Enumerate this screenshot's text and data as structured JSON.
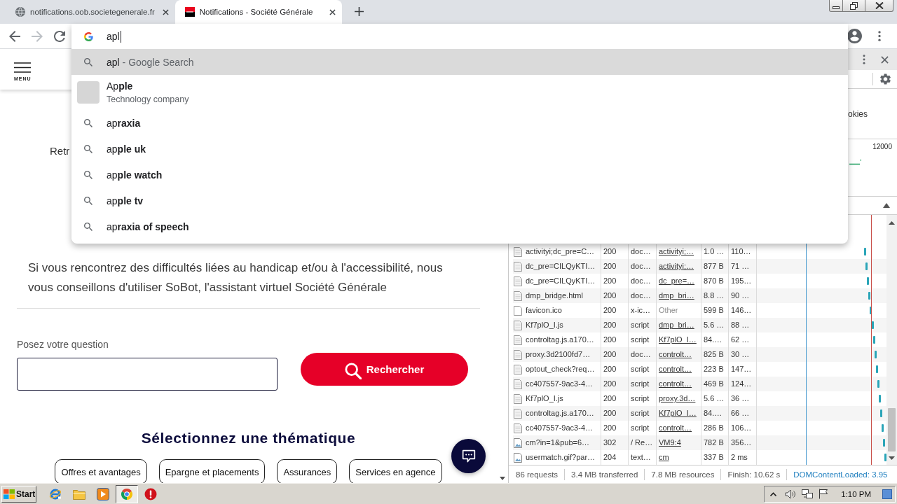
{
  "browser": {
    "tabs": [
      {
        "kind": "generic",
        "title": "notifications.oob.societegenerale.fr",
        "selected": false
      },
      {
        "kind": "site",
        "title": "Notifications - Société Générale",
        "selected": true
      }
    ],
    "nav_buttons": [
      {
        "kind": "back",
        "disabled": false
      },
      {
        "kind": "forward",
        "disabled": true
      },
      {
        "kind": "reload",
        "disabled": false
      }
    ],
    "omnibox": {
      "value": "apl",
      "suggestions": [
        {
          "kind": "search",
          "text": "apl",
          "description": "- Google Search",
          "selected": true
        },
        {
          "kind": "entity",
          "text": "Ap**ple**",
          "description": "Technology company",
          "selected": false
        },
        {
          "kind": "search",
          "text": "ap**raxia**",
          "selected": false
        },
        {
          "kind": "search",
          "text": "ap**ple uk**",
          "selected": false
        },
        {
          "kind": "search",
          "text": "ap**ple watch**",
          "selected": false
        },
        {
          "kind": "search",
          "text": "ap**ple tv**",
          "selected": false
        },
        {
          "kind": "search",
          "text": "ap**raxia of speech**",
          "selected": false
        }
      ]
    }
  },
  "page": {
    "menu_label": "MENU",
    "partial_text": "Retr",
    "notice": "Si vous rencontrez des difficultés liées au handicap et/ou à l'accessibilité, nous vous conseillons d'utiliser SoBot, l'assistant virtuel Société Générale",
    "question_label": "Posez votre question",
    "search_button": "Rechercher",
    "themes_heading": "Sélectionnez une thématique",
    "themes": [
      "Offres et avantages",
      "Epargne et placements",
      "Assurances",
      "Services en agence"
    ]
  },
  "devtools": {
    "filter_fragment": "okies",
    "overview_tick": "12000",
    "requests": [
      {
        "kind": "document",
        "name": "activityi;dc_pre=C…",
        "status": "200",
        "type": "doc…",
        "initiator": "activityi;…",
        "initiator_link": true,
        "size": "1.0 …",
        "time": "110…"
      },
      {
        "kind": "document",
        "name": "dc_pre=CILQyKTI…",
        "status": "200",
        "type": "doc…",
        "initiator": "activityi;…",
        "initiator_link": true,
        "size": "877 B",
        "time": "71 …"
      },
      {
        "kind": "document",
        "name": "dc_pre=CILQyKTI…",
        "status": "200",
        "type": "doc…",
        "initiator": "dc_pre=…",
        "initiator_link": true,
        "size": "870 B",
        "time": "195…"
      },
      {
        "kind": "document",
        "name": "dmp_bridge.html",
        "status": "200",
        "type": "doc…",
        "initiator": "dmp_bri…",
        "initiator_link": true,
        "size": "8.8 …",
        "time": "90 …"
      },
      {
        "kind": "blank",
        "name": "favicon.ico",
        "status": "200",
        "type": "x-ic…",
        "initiator": "Other",
        "initiator_link": false,
        "size": "599 B",
        "time": "146…"
      },
      {
        "kind": "document",
        "name": "Kf7plO_I.js",
        "status": "200",
        "type": "script",
        "initiator": "dmp_bri…",
        "initiator_link": true,
        "size": "5.6 …",
        "time": "88 …"
      },
      {
        "kind": "document",
        "name": "controltag.js.a170…",
        "status": "200",
        "type": "script",
        "initiator": "Kf7plO_I…",
        "initiator_link": true,
        "size": "84.…",
        "time": "62 …"
      },
      {
        "kind": "document",
        "name": "proxy.3d2100fd7…",
        "status": "200",
        "type": "doc…",
        "initiator": "controlt…",
        "initiator_link": true,
        "size": "825 B",
        "time": "30 …"
      },
      {
        "kind": "document",
        "name": "optout_check?req…",
        "status": "200",
        "type": "script",
        "initiator": "controlt…",
        "initiator_link": true,
        "size": "223 B",
        "time": "147…"
      },
      {
        "kind": "document",
        "name": "cc407557-9ac3-4…",
        "status": "200",
        "type": "script",
        "initiator": "controlt…",
        "initiator_link": true,
        "size": "469 B",
        "time": "124…"
      },
      {
        "kind": "document",
        "name": "Kf7plO_I.js",
        "status": "200",
        "type": "script",
        "initiator": "proxy.3d…",
        "initiator_link": true,
        "size": "5.6 …",
        "time": "36 …"
      },
      {
        "kind": "document",
        "name": "controltag.js.a170…",
        "status": "200",
        "type": "script",
        "initiator": "Kf7plO_I…",
        "initiator_link": true,
        "size": "84.…",
        "time": "66 …"
      },
      {
        "kind": "document",
        "name": "cc407557-9ac3-4…",
        "status": "200",
        "type": "script",
        "initiator": "controlt…",
        "initiator_link": true,
        "size": "286 B",
        "time": "106…"
      },
      {
        "kind": "image",
        "name": "cm?in=1&pub=6…",
        "status": "302",
        "type": "/ Re…",
        "initiator": "VM9:4",
        "initiator_link": true,
        "size": "782 B",
        "time": "356…"
      },
      {
        "kind": "image",
        "name": "usermatch.gif?par…",
        "status": "204",
        "type": "text…",
        "initiator": "cm",
        "initiator_link": true,
        "size": "337 B",
        "time": "2 ms"
      }
    ],
    "summary": [
      {
        "kind": "plain",
        "text": "86 requests"
      },
      {
        "kind": "plain",
        "text": "3.4 MB transferred"
      },
      {
        "kind": "plain",
        "text": "7.8 MB resources"
      },
      {
        "kind": "plain",
        "text": "Finish: 10.62 s"
      },
      {
        "kind": "domcontentloaded",
        "text": "DOMContentLoaded: 3.95"
      }
    ]
  },
  "taskbar": {
    "start_label": "Start",
    "apps": [
      {
        "kind": "ebrowser",
        "selected": false
      },
      {
        "kind": "folder",
        "selected": false
      },
      {
        "kind": "player",
        "selected": false
      },
      {
        "kind": "browser",
        "selected": true
      },
      {
        "kind": "stop",
        "selected": false
      }
    ],
    "clock": "1:10 PM"
  }
}
